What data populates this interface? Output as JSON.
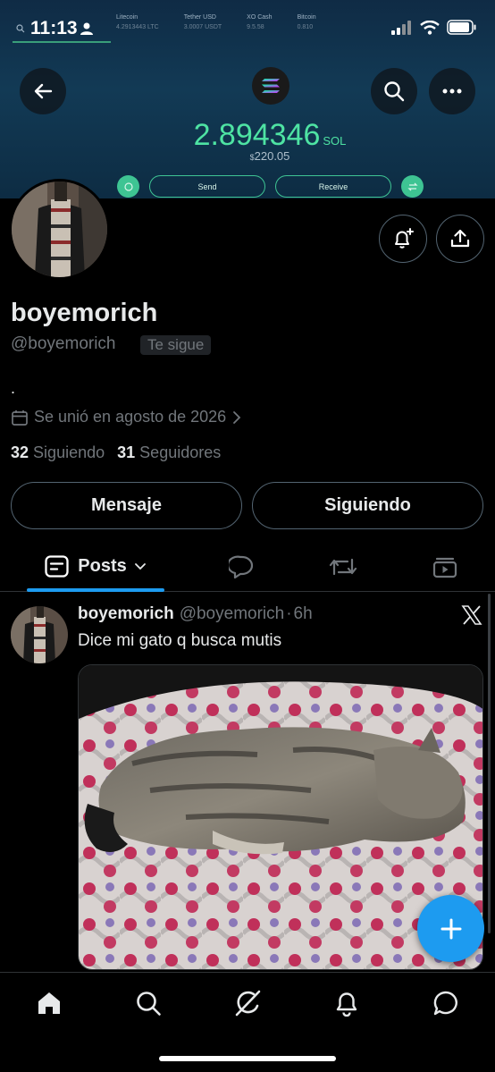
{
  "status_bar": {
    "time": "11:13"
  },
  "banner": {
    "tickers": [
      {
        "name": "Litecoin",
        "value": "4.2913443 LTC"
      },
      {
        "name": "Tether USD",
        "value": "3.0007 USDT"
      },
      {
        "name": "XO Cash",
        "value": "9.5.58"
      },
      {
        "name": "Bitcoin",
        "value": "0.810"
      }
    ],
    "amount": "2.894346",
    "unit": "SOL",
    "usd_prefix": "$",
    "usd_value": "220.05",
    "send_label": "Send",
    "receive_label": "Receive",
    "accent_color": "#3ec493"
  },
  "profile": {
    "display_name": "boyemorich",
    "handle": "@boyemorich",
    "follows_you_badge": "Te sigue",
    "bio": ".",
    "joined": "Se unió en agosto de 2026",
    "following_count": "32",
    "following_label": "Siguiendo",
    "followers_count": "31",
    "followers_label": "Seguidores",
    "message_button": "Mensaje",
    "following_button": "Siguiendo"
  },
  "tabs": {
    "posts_label": "Posts",
    "accent_color": "#1d9bf0"
  },
  "post": {
    "author_name": "boyemorich",
    "author_handle": "@boyemorich",
    "separator": "·",
    "time": "6h",
    "text": "Dice mi gato q busca mutis"
  },
  "icons": {
    "back": "arrow-left-icon",
    "search": "search-icon",
    "more": "more-horizontal-icon",
    "notify": "bell-plus-icon",
    "share": "share-icon",
    "calendar": "calendar-icon",
    "compose": "plus-icon",
    "nav": [
      "home-icon",
      "search-icon",
      "grok-icon",
      "bell-icon",
      "messages-icon"
    ]
  }
}
